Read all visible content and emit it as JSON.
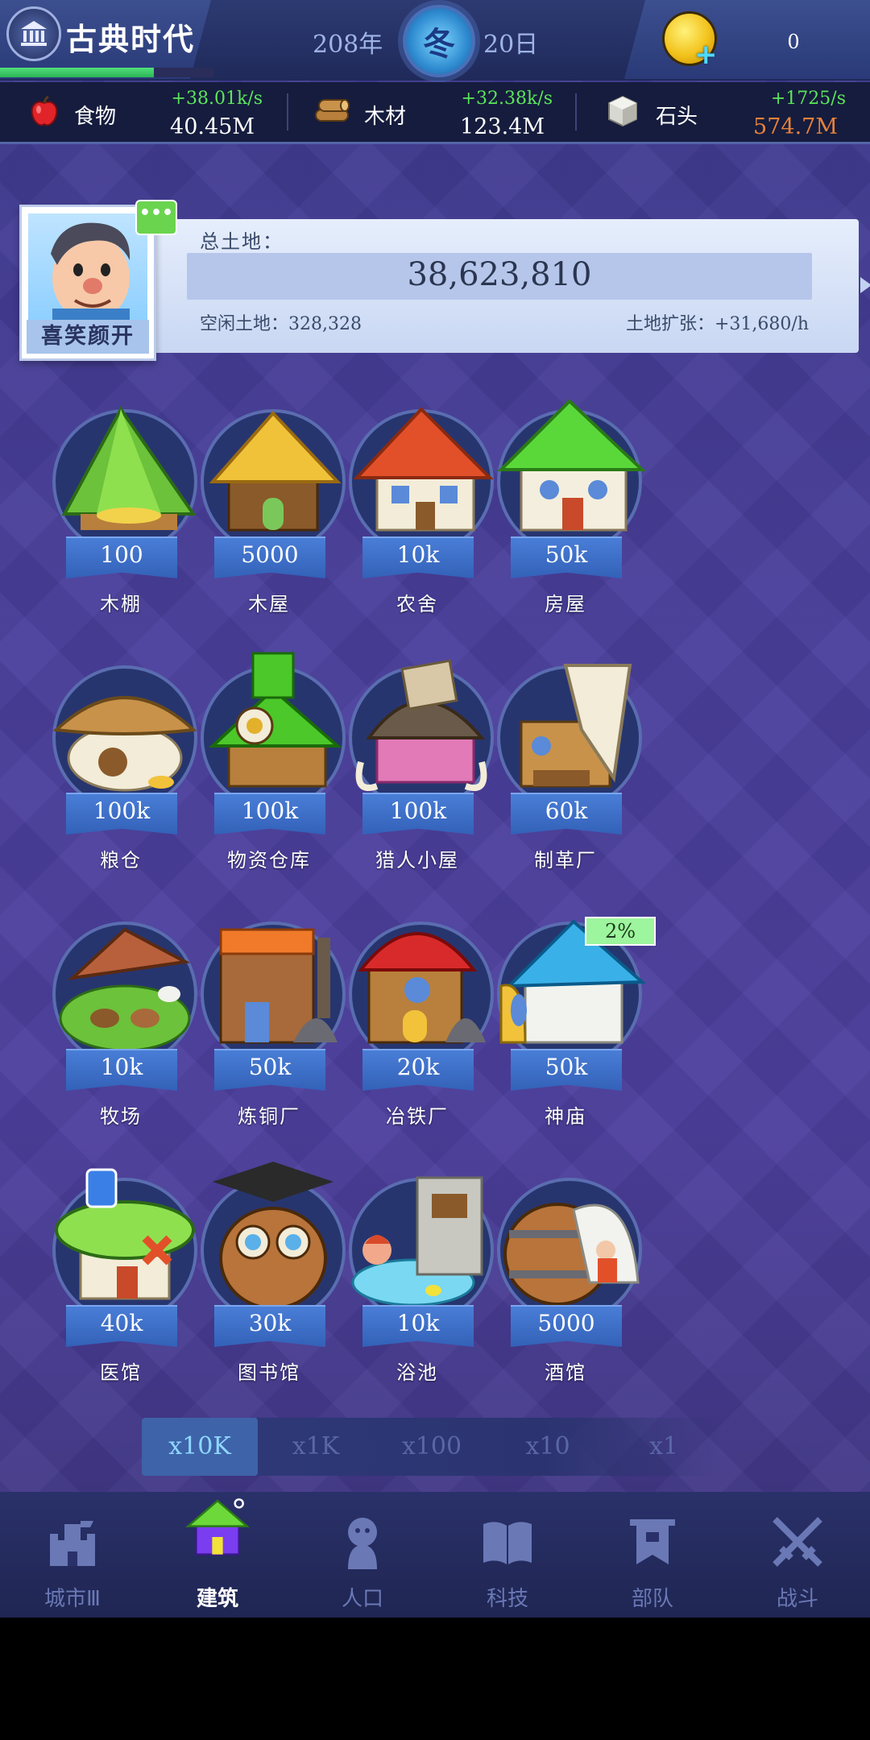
{
  "header": {
    "era_title": "古典时代",
    "era_progress": 0.72,
    "year": "208年",
    "season": "冬",
    "day": "20日",
    "coins": "0"
  },
  "resources": [
    {
      "name": "食物",
      "rate": "+38.01k/s",
      "amount": "40.45M",
      "amount_color": "#ffffff",
      "icon": "apple-icon"
    },
    {
      "name": "木材",
      "rate": "+32.38k/s",
      "amount": "123.4M",
      "amount_color": "#ffffff",
      "icon": "wood-log-icon"
    },
    {
      "name": "石头",
      "rate": "+1725/s",
      "amount": "574.7M",
      "amount_color": "#e7823a",
      "icon": "stone-block-icon"
    }
  ],
  "land": {
    "avatar_name": "喜笑颜开",
    "chat_icon": "•••",
    "total_label": "总土地：",
    "total_value": "38,623,810",
    "free_land": "空闲土地：328,328",
    "expansion": "土地扩张：+31,680/h"
  },
  "buildings": [
    {
      "name": "木棚",
      "cost": "100",
      "icon": "leaf-tent-icon"
    },
    {
      "name": "木屋",
      "cost": "5000",
      "icon": "thatched-hut-icon"
    },
    {
      "name": "农舍",
      "cost": "10k",
      "icon": "farmhouse-icon"
    },
    {
      "name": "房屋",
      "cost": "50k",
      "icon": "house-icon"
    },
    {
      "name": "粮仓",
      "cost": "100k",
      "icon": "granary-icon"
    },
    {
      "name": "物资仓库",
      "cost": "100k",
      "icon": "warehouse-icon"
    },
    {
      "name": "猎人小屋",
      "cost": "100k",
      "icon": "hunter-lodge-icon"
    },
    {
      "name": "制革厂",
      "cost": "60k",
      "icon": "tannery-icon"
    },
    {
      "name": "牧场",
      "cost": "10k",
      "icon": "ranch-icon"
    },
    {
      "name": "炼铜厂",
      "cost": "50k",
      "icon": "copper-smelter-icon"
    },
    {
      "name": "冶铁厂",
      "cost": "20k",
      "icon": "iron-smelter-icon"
    },
    {
      "name": "神庙",
      "cost": "50k",
      "icon": "temple-icon"
    },
    {
      "name": "医馆",
      "cost": "40k",
      "icon": "clinic-icon"
    },
    {
      "name": "图书馆",
      "cost": "30k",
      "icon": "library-icon"
    },
    {
      "name": "浴池",
      "cost": "10k",
      "icon": "bathhouse-icon"
    },
    {
      "name": "酒馆",
      "cost": "5000",
      "icon": "tavern-icon"
    }
  ],
  "progress_badge": "2%",
  "multipliers": [
    {
      "label": "x10K",
      "active": true
    },
    {
      "label": "x1K",
      "active": false
    },
    {
      "label": "x100",
      "active": false
    },
    {
      "label": "x10",
      "active": false
    },
    {
      "label": "x1",
      "active": false
    }
  ],
  "nav": [
    {
      "label": "城市Ⅲ",
      "icon": "castle-icon",
      "active": false
    },
    {
      "label": "建筑",
      "icon": "building-house-icon",
      "active": true
    },
    {
      "label": "人口",
      "icon": "person-icon",
      "active": false
    },
    {
      "label": "科技",
      "icon": "book-icon",
      "active": false
    },
    {
      "label": "部队",
      "icon": "banner-icon",
      "active": false
    },
    {
      "label": "战斗",
      "icon": "crossed-swords-icon",
      "active": false
    }
  ],
  "colors": {
    "accent_green": "#5be65b",
    "ribbon_blue": "#3d6cc6",
    "stone_amount": "#e7823a",
    "active_nav": "#7a3df0"
  }
}
